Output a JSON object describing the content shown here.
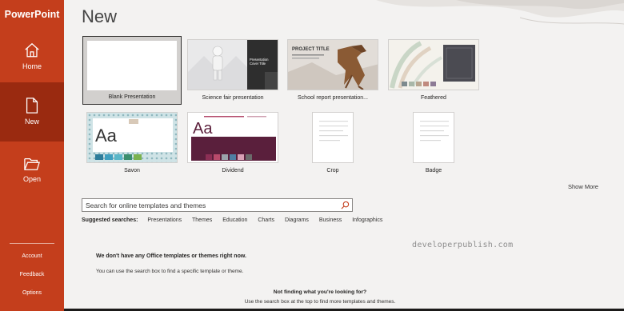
{
  "app": {
    "title": "PowerPoint"
  },
  "sidebar": {
    "items": [
      {
        "label": "Home",
        "icon": "home-icon"
      },
      {
        "label": "New",
        "icon": "new-document-icon",
        "selected": true
      },
      {
        "label": "Open",
        "icon": "folder-open-icon"
      }
    ],
    "bottom": [
      {
        "label": "Account"
      },
      {
        "label": "Feedback"
      },
      {
        "label": "Options"
      }
    ]
  },
  "colors": {
    "sidebar": "#c43e1c",
    "sidebar_selected": "#9a2a10",
    "background": "#f3f2f1",
    "accent": "#c43e1c"
  },
  "page_title": "New",
  "templates": [
    {
      "name": "Blank Presentation",
      "selected": true
    },
    {
      "name": "Science fair presentation",
      "thumb_text": [
        "Presentation",
        "Cover Title"
      ]
    },
    {
      "name": "School report presentation...",
      "thumb_text": [
        "PROJECT TITLE"
      ]
    },
    {
      "name": "Feathered"
    },
    {
      "name": "Savon",
      "thumb_text": [
        "Aa"
      ]
    },
    {
      "name": "Dividend",
      "thumb_text": [
        "Aa"
      ]
    },
    {
      "name": "Crop"
    },
    {
      "name": "Badge"
    }
  ],
  "show_more": "Show More",
  "search": {
    "placeholder": "Search for online templates and themes",
    "value": ""
  },
  "suggested": {
    "label": "Suggested searches:",
    "items": [
      "Presentations",
      "Themes",
      "Education",
      "Charts",
      "Diagrams",
      "Business",
      "Infographics"
    ]
  },
  "watermark": "developerpublish.com",
  "messages": {
    "no_templates_title": "We don't have any Office templates or themes right now.",
    "no_templates_body": "You can use the search box to find a specific template or theme.",
    "not_finding_title": "Not finding what you're looking for?",
    "not_finding_body": "Use the search box at the top to find more templates and themes."
  }
}
